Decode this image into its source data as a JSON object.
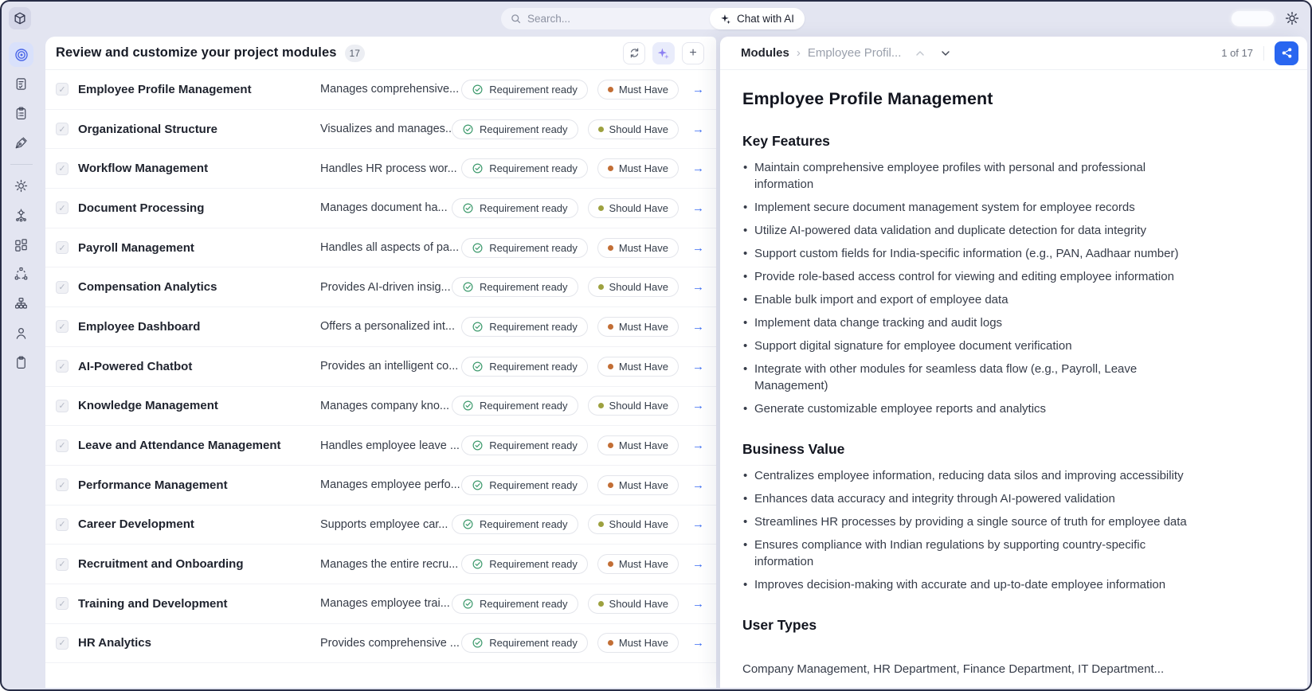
{
  "colors": {
    "accent_blue": "#2966f0",
    "active_icon_blue": "#4a66e8",
    "status_green": "#3f9b6e",
    "must_have_dot": "#c26e35",
    "should_have_dot": "#9da13f",
    "row_arrow_blue": "#3a6cf3"
  },
  "icons": {
    "checkbox_check": "✓",
    "row_arrow": "→",
    "breadcrumb_separator": "›",
    "plus": "+"
  },
  "topbar": {
    "search_placeholder": "Search...",
    "chat_label": "Chat with AI"
  },
  "sidebar": {
    "icons": [
      "target-icon",
      "requirements-doc-icon",
      "task-clipboard-icon",
      "pen-tool-icon",
      "settings-gear-icon",
      "ai-gear-icon",
      "modules-grid-icon",
      "deploy-nodes-icon",
      "org-chart-icon",
      "user-icon",
      "clipboard-icon"
    ],
    "active_index": 0
  },
  "modules_panel": {
    "title": "Review and customize your project modules",
    "count": "17",
    "rows": [
      {
        "name": "Employee Profile Management",
        "description": "Manages comprehensive...",
        "status": "Requirement ready",
        "priority": "Must Have"
      },
      {
        "name": "Organizational Structure",
        "description": "Visualizes and manages...",
        "status": "Requirement ready",
        "priority": "Should Have"
      },
      {
        "name": "Workflow Management",
        "description": "Handles HR process wor...",
        "status": "Requirement ready",
        "priority": "Must Have"
      },
      {
        "name": "Document Processing",
        "description": "Manages document ha...",
        "status": "Requirement ready",
        "priority": "Should Have"
      },
      {
        "name": "Payroll Management",
        "description": "Handles all aspects of pa...",
        "status": "Requirement ready",
        "priority": "Must Have"
      },
      {
        "name": "Compensation Analytics",
        "description": "Provides AI-driven insig...",
        "status": "Requirement ready",
        "priority": "Should Have"
      },
      {
        "name": "Employee Dashboard",
        "description": "Offers a personalized int...",
        "status": "Requirement ready",
        "priority": "Must Have"
      },
      {
        "name": "AI-Powered Chatbot",
        "description": "Provides an intelligent co...",
        "status": "Requirement ready",
        "priority": "Must Have"
      },
      {
        "name": "Knowledge Management",
        "description": "Manages company kno...",
        "status": "Requirement ready",
        "priority": "Should Have"
      },
      {
        "name": "Leave and Attendance Management",
        "description": "Handles employee leave ...",
        "status": "Requirement ready",
        "priority": "Must Have"
      },
      {
        "name": "Performance Management",
        "description": "Manages employee perfo...",
        "status": "Requirement ready",
        "priority": "Must Have"
      },
      {
        "name": "Career Development",
        "description": "Supports employee car...",
        "status": "Requirement ready",
        "priority": "Should Have"
      },
      {
        "name": "Recruitment and Onboarding",
        "description": "Manages the entire recru...",
        "status": "Requirement ready",
        "priority": "Must Have"
      },
      {
        "name": "Training and Development",
        "description": "Manages employee trai...",
        "status": "Requirement ready",
        "priority": "Should Have"
      },
      {
        "name": "HR Analytics",
        "description": "Provides comprehensive ...",
        "status": "Requirement ready",
        "priority": "Must Have"
      }
    ]
  },
  "detail_panel": {
    "breadcrumb": {
      "root": "Modules",
      "current": "Employee Profil..."
    },
    "pagination": "1 of 17",
    "title": "Employee Profile Management",
    "sections": [
      {
        "heading": "Key Features",
        "bullets": [
          "Maintain comprehensive employee profiles with personal and professional\ninformation",
          "Implement secure document management system for employee records",
          "Utilize AI-powered data validation and duplicate detection for data integrity",
          "Support custom fields for India-specific information (e.g., PAN, Aadhaar number)",
          "Provide role-based access control for viewing and editing employee information",
          "Enable bulk import and export of employee data",
          "Implement data change tracking and audit logs",
          "Support digital signature for employee document verification",
          "Integrate with other modules for seamless data flow (e.g., Payroll, Leave\nManagement)",
          "Generate customizable employee reports and analytics"
        ]
      },
      {
        "heading": "Business Value",
        "bullets": [
          "Centralizes employee information, reducing data silos and improving accessibility",
          "Enhances data accuracy and integrity through AI-powered validation",
          "Streamlines HR processes by providing a single source of truth for employee data",
          "Ensures compliance with Indian regulations by supporting country-specific\ninformation",
          "Improves decision-making with accurate and up-to-date employee information"
        ]
      },
      {
        "heading": "User Types",
        "paragraph": "Company Management, HR Department, Finance Department, IT Department..."
      }
    ]
  }
}
